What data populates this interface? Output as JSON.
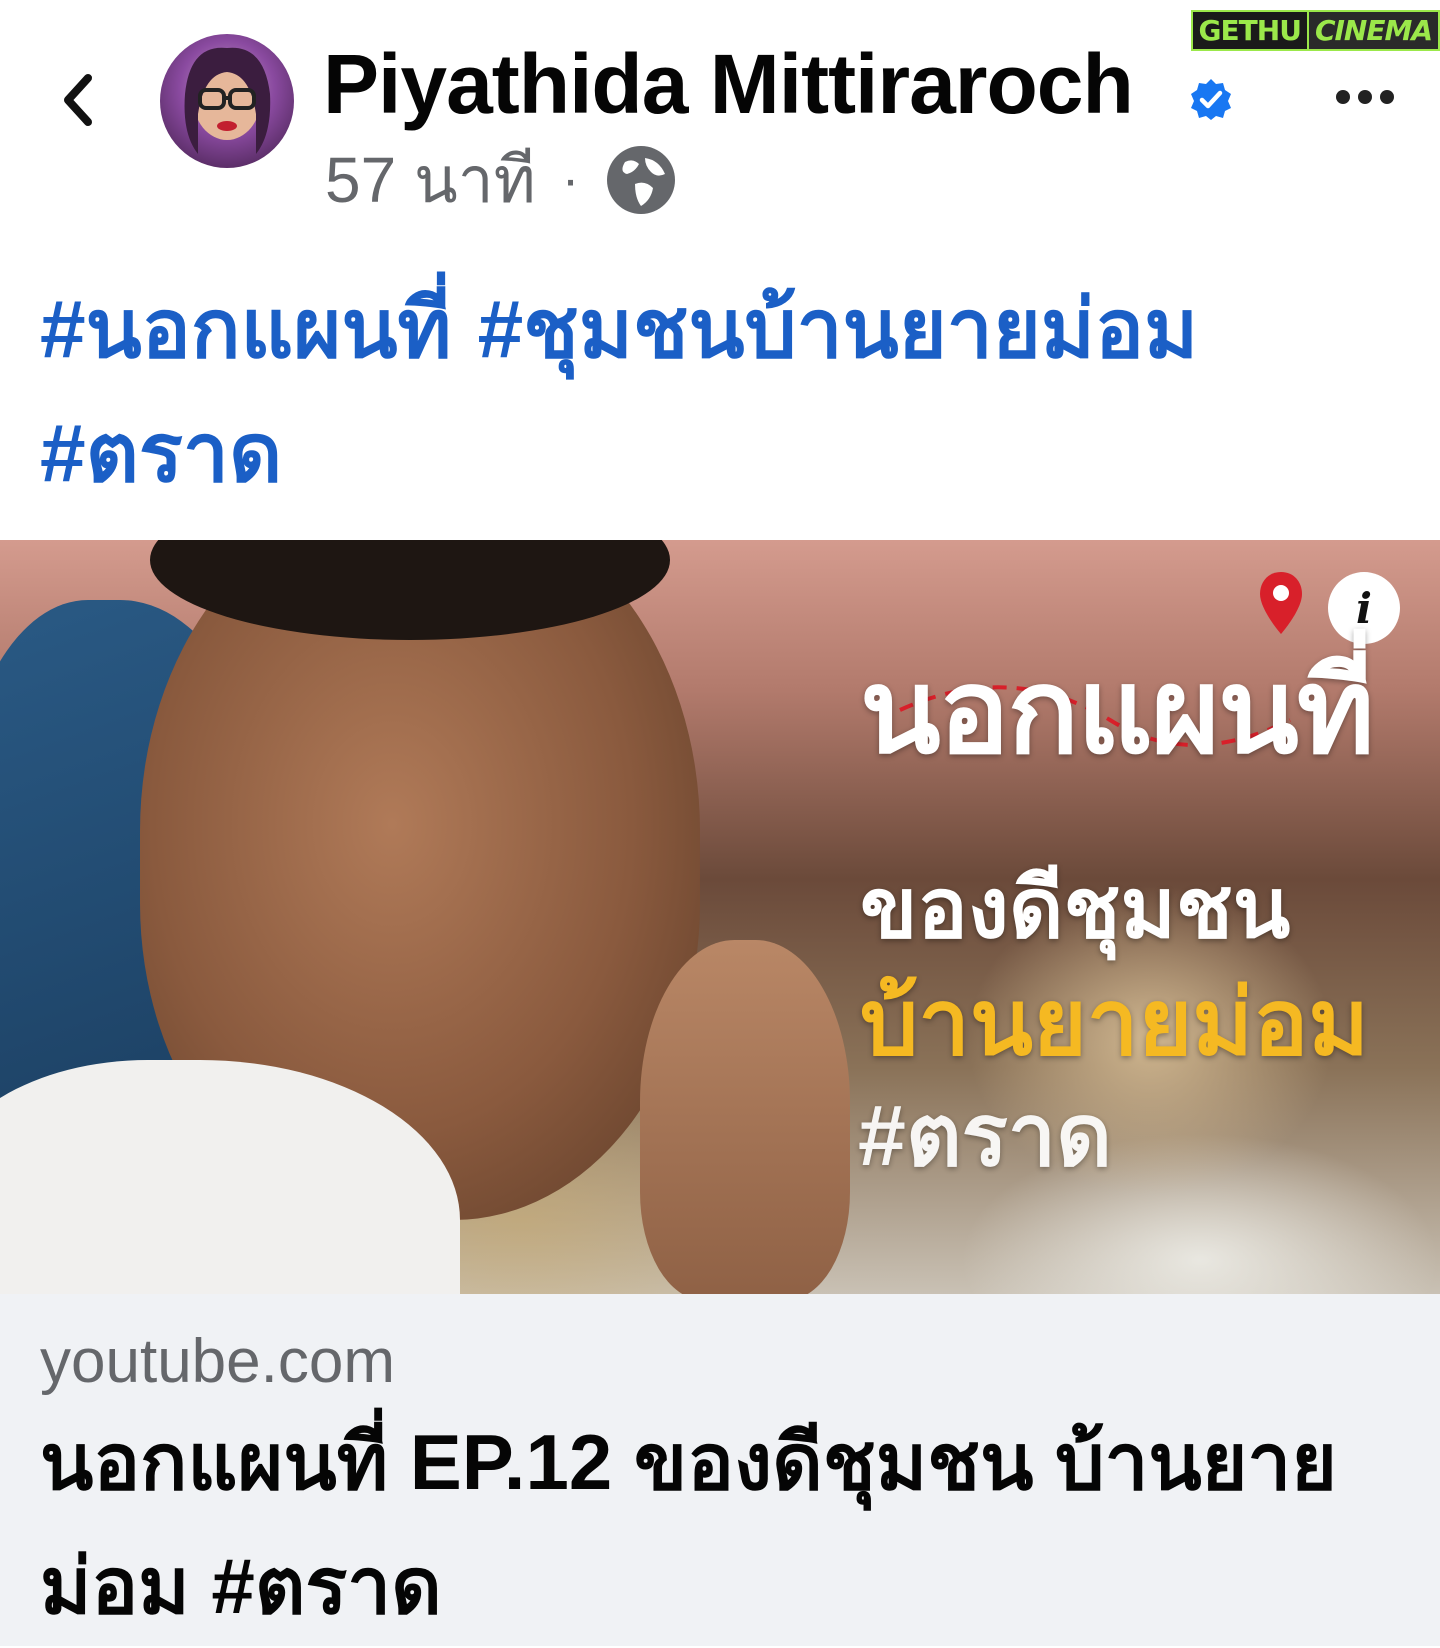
{
  "watermark": {
    "part1": "GETHU",
    "part2": "CINEMA"
  },
  "post": {
    "author": "Piyathida Mittiraroch",
    "time": "57 นาที",
    "separator": "·",
    "privacy_icon": "globe-icon",
    "verified_icon": "verified-badge-icon",
    "hashtags": [
      "#นอกแผนที่",
      "#ชุมชนบ้านยายม่อม",
      "#ตราด"
    ]
  },
  "media": {
    "overlay_title": "นอกแผนที่",
    "overlay_line1": "ของดีชุมชน",
    "overlay_line2": "บ้านยายม่อม",
    "overlay_line3": "#ตราด",
    "info_icon": "i"
  },
  "link": {
    "domain": "youtube.com",
    "title": "นอกแผนที่ EP.12 ของดีชุมชน บ้านยายม่อม #ตราด"
  },
  "colors": {
    "hashtag": "#1b5fc6",
    "verified": "#1877f2",
    "secondary_text": "#65676b",
    "overlay_accent": "#f5b922"
  }
}
